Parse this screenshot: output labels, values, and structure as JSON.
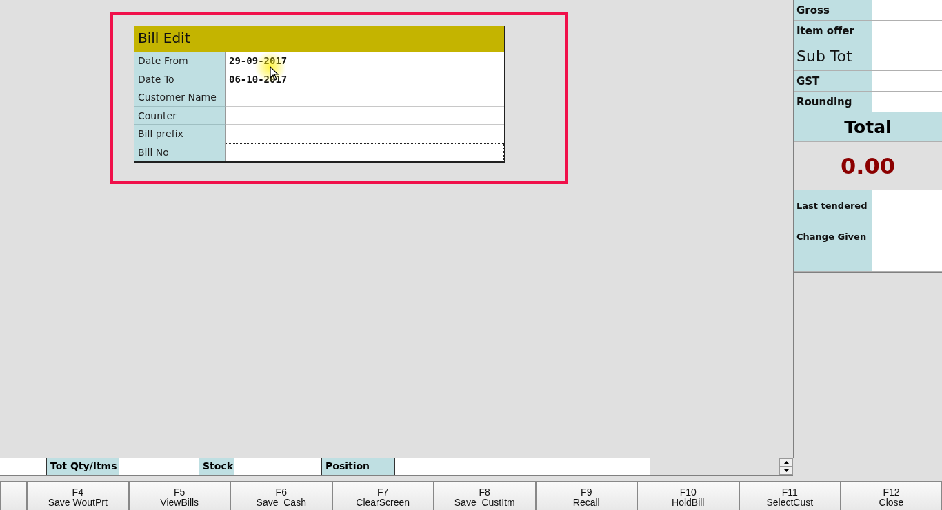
{
  "bill_edit": {
    "title": "Bill Edit",
    "highlighted": true,
    "fields": [
      {
        "label": "Date From",
        "value": "29-09-2017",
        "focused": false
      },
      {
        "label": "Date To",
        "value": "06-10-2017",
        "focused": false
      },
      {
        "label": "Customer Name",
        "focused": false
      },
      {
        "label": "Counter",
        "focused": false
      },
      {
        "label": "Bill prefix",
        "focused": false
      },
      {
        "label": "Bill No",
        "focused": true
      }
    ]
  },
  "summary": [
    {
      "kind": "row",
      "label": "Gross"
    },
    {
      "kind": "row",
      "label": "Item offer"
    },
    {
      "kind": "large",
      "label": "Sub Tot"
    },
    {
      "kind": "row",
      "label": "GST"
    },
    {
      "kind": "row",
      "label": "Rounding"
    },
    {
      "kind": "heading",
      "label": "Total"
    },
    {
      "kind": "amount",
      "label": "0.00"
    },
    {
      "kind": "tall",
      "label": "Last tendered"
    },
    {
      "kind": "tall",
      "label": "Change Given"
    },
    {
      "kind": "blank"
    }
  ],
  "status_bar": [
    {
      "kind": "value"
    },
    {
      "kind": "label",
      "label": "Tot Qty/Itms"
    },
    {
      "kind": "value"
    },
    {
      "kind": "label",
      "label": "Stock"
    },
    {
      "kind": "value"
    },
    {
      "kind": "label",
      "label": "Position"
    },
    {
      "kind": "value"
    },
    {
      "kind": "grey"
    }
  ],
  "function_keys": [
    {
      "key": "F4",
      "label": "Save WoutPrt"
    },
    {
      "key": "F5",
      "label": "ViewBills"
    },
    {
      "key": "F6",
      "label": "Save  Cash"
    },
    {
      "key": "F7",
      "label": "ClearScreen"
    },
    {
      "key": "F8",
      "label": "Save  CustItm"
    },
    {
      "key": "F9",
      "label": "Recall"
    },
    {
      "key": "F10",
      "label": "HoldBill"
    },
    {
      "key": "F11",
      "label": "SelectCust"
    },
    {
      "key": "F12",
      "label": "Close"
    }
  ]
}
